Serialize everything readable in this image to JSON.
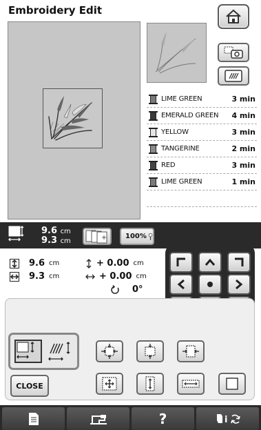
{
  "header": {
    "title": "Embroidery Edit"
  },
  "icons": {
    "home": "home-icon",
    "camera": "camera-icon",
    "pattern": "stitch-pattern-icon",
    "size": "size-icon",
    "layers": "layers-icon",
    "zoom": "zoom-icon",
    "rotate": "rotate-icon"
  },
  "threads": [
    {
      "name": "LIME GREEN",
      "time": "3 min",
      "color": "#7a7a7a"
    },
    {
      "name": "EMERALD GREEN",
      "time": "4 min",
      "color": "#3a3a3a"
    },
    {
      "name": "YELLOW",
      "time": "3 min",
      "color": "#e6e6e6"
    },
    {
      "name": "TANGERINE",
      "time": "2 min",
      "color": "#8a8a8a"
    },
    {
      "name": "RED",
      "time": "3 min",
      "color": "#454545"
    },
    {
      "name": "LIME GREEN",
      "time": "1 min",
      "color": "#7a7a7a"
    }
  ],
  "size": {
    "width": "9.6",
    "height": "9.3",
    "unit": "cm"
  },
  "zoom": {
    "label": "100%"
  },
  "info": {
    "height": "9.6",
    "width": "9.3",
    "unit": "cm",
    "offset_y": "+ 0.00",
    "offset_x": "+ 0.00",
    "rotation": "0°"
  },
  "buttons": {
    "close": "CLOSE"
  },
  "bottom_bar": {
    "help": "?"
  }
}
